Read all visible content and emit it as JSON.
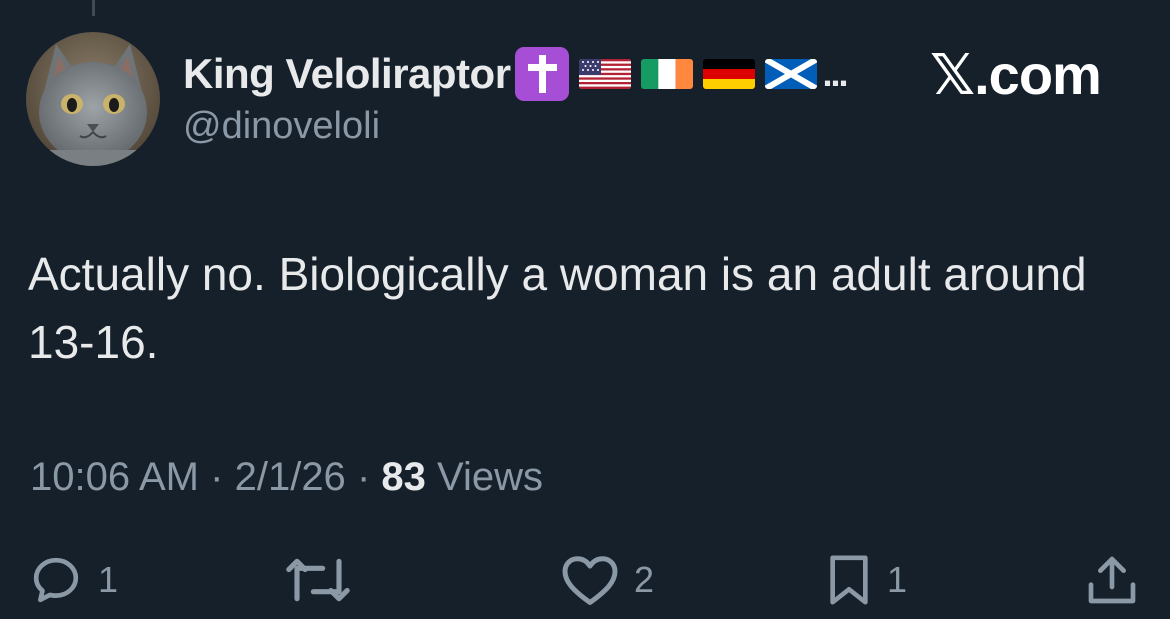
{
  "author": {
    "display_name": "King Veloliraptor",
    "name_emojis": [
      "latin-cross-emoji",
      "us-flag-emoji",
      "ireland-flag-emoji",
      "germany-flag-emoji",
      "scotland-flag-emoji"
    ],
    "truncation": "...",
    "handle": "@dinoveloli",
    "avatar": "gray-cat-avatar"
  },
  "brand": {
    "text": "𝕏.com"
  },
  "tweet": {
    "text": "Actually no. Biologically a woman is an adult around 13-16."
  },
  "meta": {
    "time": "10:06 AM",
    "separator": "·",
    "date": "2/1/26",
    "views_count": "83",
    "views_label": "Views"
  },
  "actions": {
    "reply_count": "1",
    "retweet_count": "",
    "like_count": "2",
    "bookmark_count": "1"
  },
  "colors": {
    "background": "#15202b",
    "text_primary": "#e7e9ea",
    "text_secondary": "#8b98a5",
    "cross_emoji_bg": "#a64fd6"
  }
}
